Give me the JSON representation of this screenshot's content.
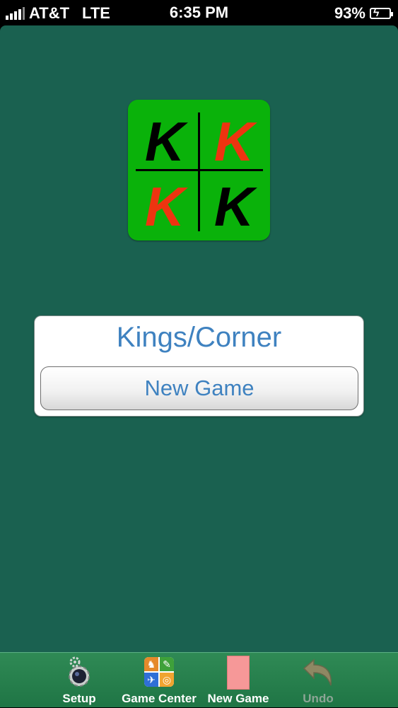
{
  "status_bar": {
    "carrier": "AT&T",
    "network": "LTE",
    "time": "6:35 PM",
    "battery": "93%"
  },
  "logo": {
    "letter": "K",
    "colors": {
      "background": "#0ab20a",
      "red": "#ee3410",
      "black": "#000000"
    }
  },
  "game_card": {
    "title": "Kings/Corner",
    "button_label": "New Game"
  },
  "tab_bar": {
    "items": [
      {
        "label": "Setup",
        "icon": "gear-icon",
        "enabled": true
      },
      {
        "label": "Game Center",
        "icon": "game-center-icon",
        "enabled": true
      },
      {
        "label": "New Game",
        "icon": "card-back-icon",
        "enabled": true
      },
      {
        "label": "Undo",
        "icon": "undo-arrow-icon",
        "enabled": false
      }
    ]
  },
  "colors": {
    "felt": "#1a6150",
    "accent_text": "#3f82c0",
    "tab_bar": "#2f8a55"
  }
}
